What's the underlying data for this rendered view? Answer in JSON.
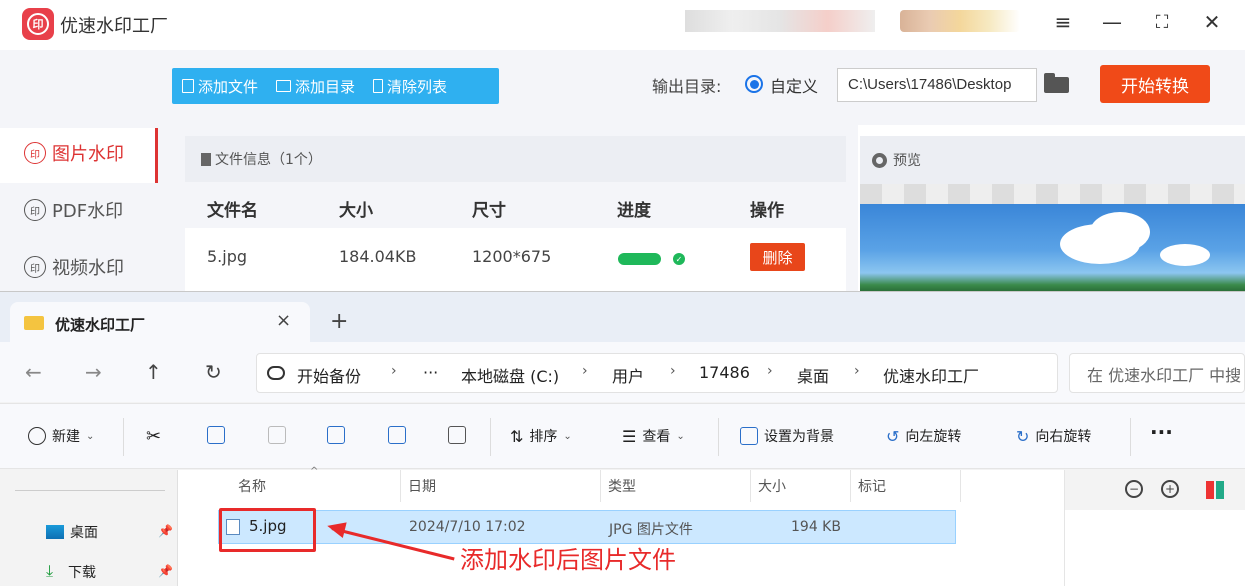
{
  "app": {
    "title": "优速水印工厂",
    "logo_text": "印",
    "toolbar": {
      "add_file": "添加文件",
      "add_dir": "添加目录",
      "clear_list": "清除列表"
    },
    "output": {
      "label": "输出目录:",
      "option": "自定义",
      "path": "C:\\Users\\17486\\Desktop"
    },
    "start_button": "开始转换",
    "sidebar": {
      "items": [
        {
          "label": "图片水印",
          "icon": "印"
        },
        {
          "label": "PDF水印",
          "icon": "印"
        },
        {
          "label": "视频水印",
          "icon": "印"
        }
      ]
    },
    "file_info": {
      "header": "文件信息（1个）",
      "columns": [
        "文件名",
        "大小",
        "尺寸",
        "进度",
        "操作"
      ],
      "rows": [
        {
          "name": "5.jpg",
          "size": "184.04KB",
          "dims": "1200*675",
          "progress": 100,
          "action": "删除"
        }
      ]
    },
    "preview": {
      "header": "预览"
    },
    "colors": {
      "accent_blue": "#2fb0f0",
      "start_orange": "#f04a18",
      "active_red": "#dd3333",
      "progress_green": "#1fb85a"
    }
  },
  "explorer": {
    "tab": {
      "title": "优速水印工厂",
      "close": "×",
      "add": "+"
    },
    "nav": {
      "back": "←",
      "forward": "→",
      "up": "↑",
      "refresh": "↻"
    },
    "address": {
      "backup": "开始备份",
      "more": "···",
      "crumbs": [
        "本地磁盘 (C:)",
        "用户",
        "17486",
        "桌面",
        "优速水印工厂"
      ],
      "sep": "›"
    },
    "search_placeholder": "在 优速水印工厂 中搜",
    "commands": {
      "new": "新建",
      "sort": "排序",
      "view": "查看",
      "set_bg": "设置为背景",
      "rotate_left": "向左旋转",
      "rotate_right": "向右旋转",
      "more": "···"
    },
    "nav_pane": [
      {
        "label": "桌面"
      },
      {
        "label": "下载"
      }
    ],
    "columns": [
      "名称",
      "日期",
      "类型",
      "大小",
      "标记"
    ],
    "files": [
      {
        "name": "5.jpg",
        "date": "2024/7/10 17:02",
        "type": "JPG 图片文件",
        "size": "194 KB",
        "tag": ""
      }
    ]
  },
  "annotation": {
    "text": "添加水印后图片文件",
    "color": "#e82a2a"
  }
}
